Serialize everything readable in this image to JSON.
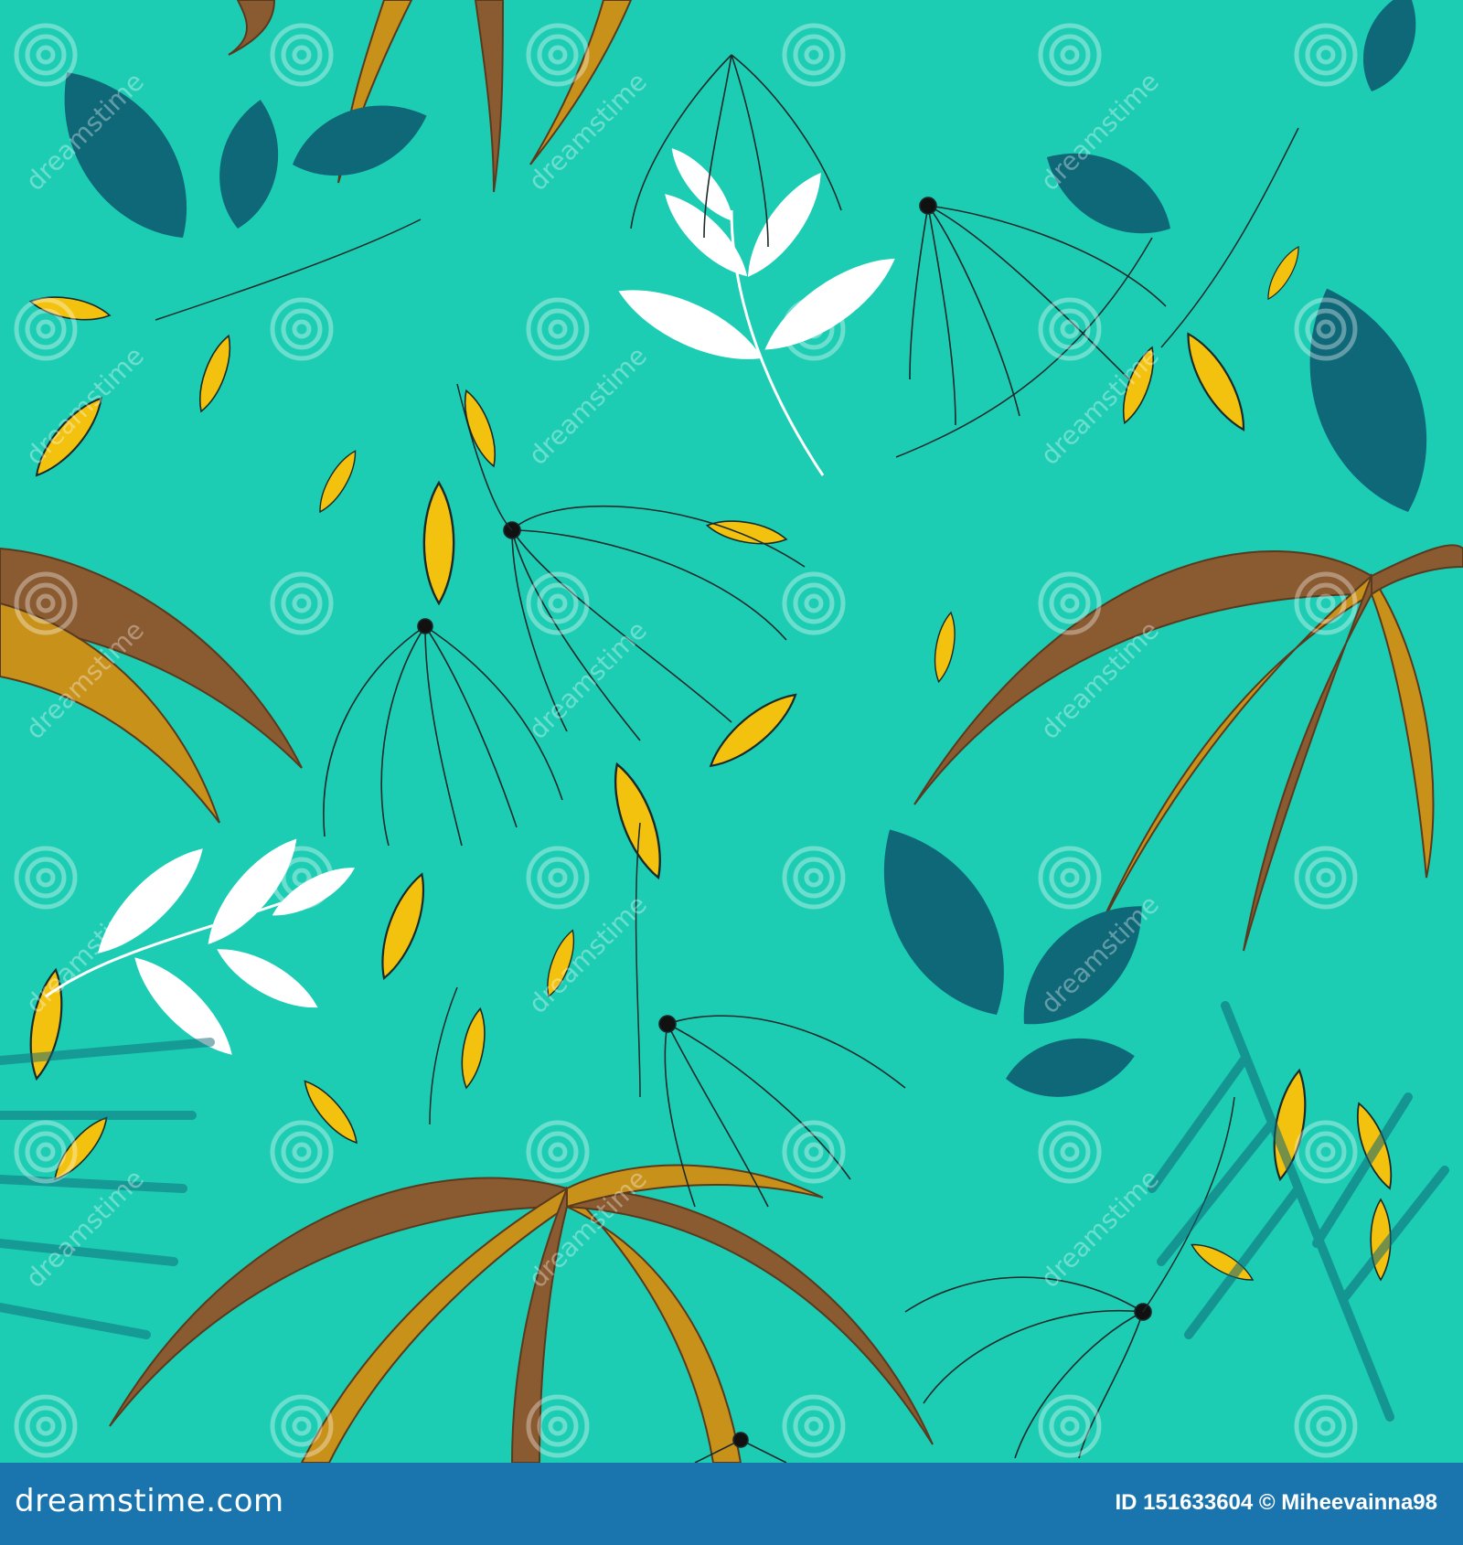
{
  "artwork": {
    "background_color": "#1ccdb4",
    "palette": {
      "teal_leaf": "#0f6878",
      "yellow_leaf": "#f2c20f",
      "brown_frond": "#8a5a30",
      "gold_frond": "#c8911a",
      "white_leaf": "#ffffff",
      "outline": "#1a2a2a"
    },
    "watermark_word": "dreamstime"
  },
  "footer": {
    "background_color": "#1a74ad",
    "brand": "dreamstime.com",
    "id_line": "ID 151633604 © Miheevainna98"
  }
}
